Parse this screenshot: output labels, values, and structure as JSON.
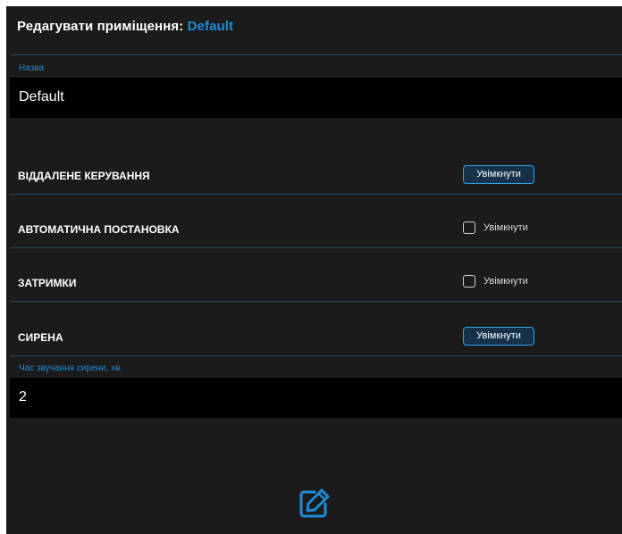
{
  "header": {
    "title_prefix": "Редагувати приміщення:",
    "title_name": "Default"
  },
  "name_field": {
    "label": "Назва",
    "value": "Default"
  },
  "remote_control": {
    "label": "ВІДДАЛЕНЕ КЕРУВАННЯ",
    "button_label": "Увімкнути"
  },
  "auto_arming": {
    "label": "АВТОМАТИЧНА ПОСТАНОВКА",
    "checkbox_label": "Увімкнути",
    "checked": false
  },
  "delays": {
    "label": "ЗАТРИМКИ",
    "checkbox_label": "Увімкнути",
    "checked": false
  },
  "siren": {
    "label": "СИРЕНА",
    "button_label": "Увімкнути"
  },
  "siren_duration_field": {
    "label": "Час звучання сирени, хв.",
    "value": "2"
  },
  "actions": {
    "edit_icon": "edit-icon"
  },
  "colors": {
    "accent": "#1f8bd6",
    "panel_bg": "#1b1b1b",
    "field_bg": "#000000",
    "divider": "#1f4a66"
  }
}
